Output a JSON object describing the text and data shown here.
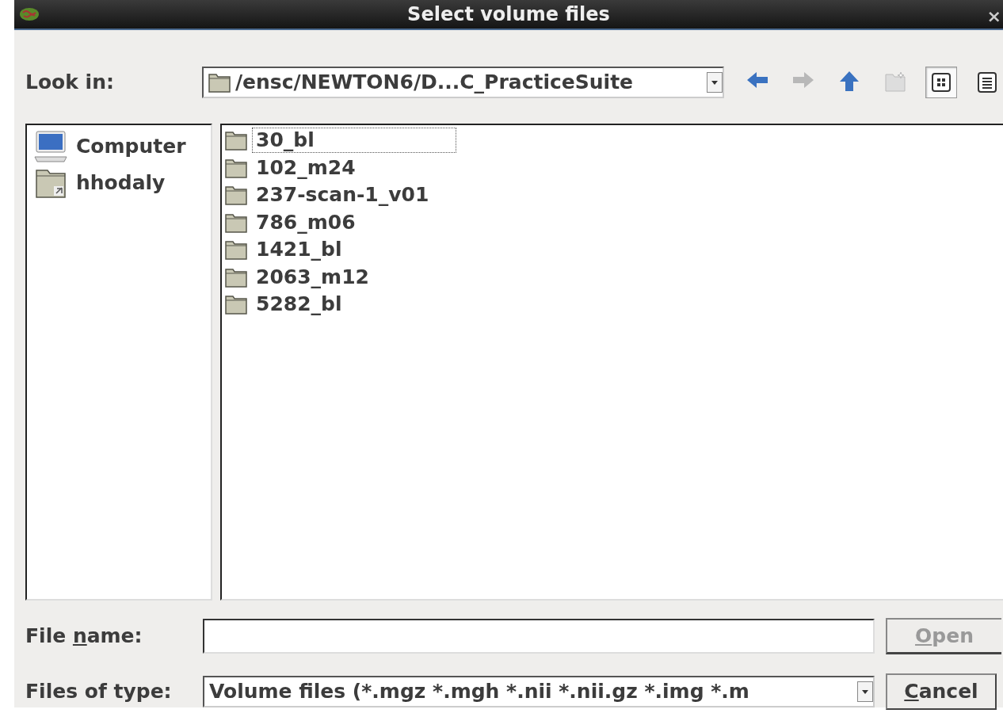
{
  "window": {
    "title": "Select volume files",
    "close": "×"
  },
  "look_in": {
    "label": "Look in:",
    "value": "/ensc/NEWTON6/D...C_PracticeSuite"
  },
  "toolbar": [
    {
      "kind": "back",
      "disabled": false,
      "selected": false
    },
    {
      "kind": "forward",
      "disabled": true,
      "selected": false
    },
    {
      "kind": "up",
      "disabled": false,
      "selected": false
    },
    {
      "kind": "new-folder",
      "disabled": true,
      "selected": false
    },
    {
      "kind": "icon-view",
      "disabled": false,
      "selected": true
    },
    {
      "kind": "detail-view",
      "disabled": false,
      "selected": false
    }
  ],
  "sidebar": {
    "items": [
      {
        "kind": "computer",
        "label": "Computer"
      },
      {
        "kind": "home",
        "label": "hhodaly"
      }
    ]
  },
  "files": [
    {
      "name": "30_bl",
      "focused": true
    },
    {
      "name": "102_m24",
      "focused": false
    },
    {
      "name": "237-scan-1_v01",
      "focused": false
    },
    {
      "name": "786_m06",
      "focused": false
    },
    {
      "name": "1421_bl",
      "focused": false
    },
    {
      "name": "2063_m12",
      "focused": false
    },
    {
      "name": "5282_bl",
      "focused": false
    }
  ],
  "file_name": {
    "label": {
      "before": "File ",
      "key": "n",
      "after": "ame:"
    }
  },
  "file_type": {
    "label": "Files of type:",
    "value": "Volume files (*.mgz *.mgh *.nii *.nii.gz *.img *.m"
  },
  "buttons": [
    {
      "label": {
        "key": "O",
        "after": "pen"
      },
      "disabled": true
    },
    {
      "label": {
        "key": "C",
        "after": "ancel"
      },
      "disabled": false
    }
  ]
}
